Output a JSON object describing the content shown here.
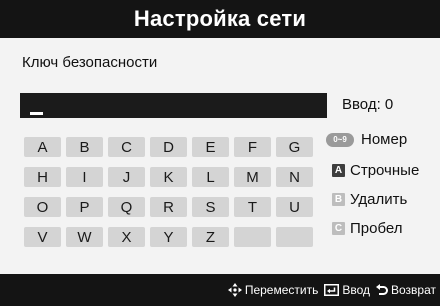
{
  "title": "Настройка сети",
  "field_label": "Ключ безопасности",
  "input": {
    "value": "",
    "count_text": "Ввод: 0"
  },
  "keys": [
    "A",
    "B",
    "C",
    "D",
    "E",
    "F",
    "G",
    "H",
    "I",
    "J",
    "K",
    "L",
    "M",
    "N",
    "O",
    "P",
    "Q",
    "R",
    "S",
    "T",
    "U",
    "V",
    "W",
    "X",
    "Y",
    "Z",
    "",
    ""
  ],
  "options": {
    "number": {
      "badge": "0~9",
      "label": "Номер"
    },
    "lowercase": {
      "badge": "A",
      "label": "Строчные",
      "color": "#3d3d3d"
    },
    "delete": {
      "badge": "B",
      "label": "Удалить",
      "color": "#bdbdbd"
    },
    "space": {
      "badge": "C",
      "label": "Пробел",
      "color": "#bdbdbd"
    }
  },
  "footer": {
    "move": {
      "icon": "move-arrows-icon",
      "label": "Переместить"
    },
    "enter": {
      "icon": "enter-icon",
      "label": "Ввод"
    },
    "back": {
      "icon": "return-icon",
      "label": "Возврат"
    }
  }
}
